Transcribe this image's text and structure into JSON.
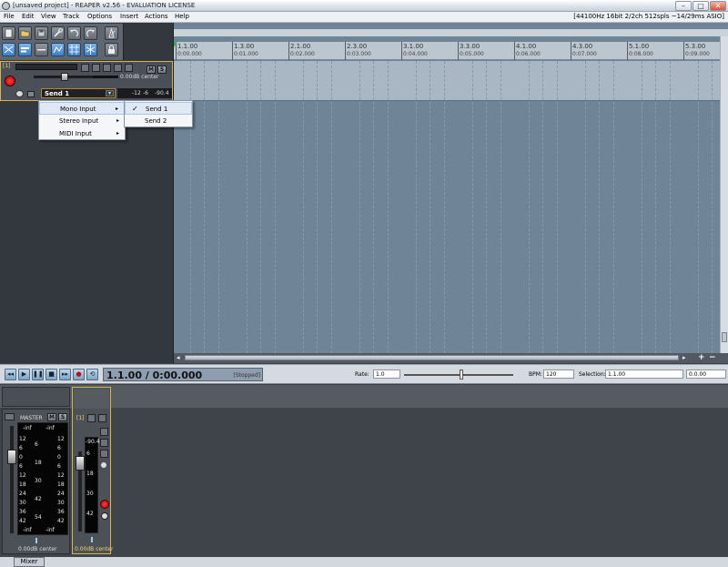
{
  "window": {
    "title": "[unsaved project] - REAPER v2.56 - EVALUATION LICENSE",
    "minimize": "–",
    "maximize": "□",
    "close": "✕"
  },
  "menu": [
    "File",
    "Edit",
    "View",
    "Track",
    "Options",
    "Insert",
    "Actions",
    "Help"
  ],
  "audio_status": "[44100Hz 16bit 2/2ch 512spls ~14/29ms ASIO]",
  "toolbar": {
    "buttons": [
      "new-project",
      "open-project",
      "save-project",
      "settings-wrench",
      "undo",
      "redo",
      "metronome",
      "auto-crossfade",
      "ripple-edit",
      "envelope-lock",
      "grid-snap",
      "snap-toggle",
      "lock"
    ]
  },
  "track": {
    "number": "[1]",
    "name": "",
    "volume": "0.00dB center",
    "mute": "M",
    "solo": "S",
    "send_name": "Send 1",
    "meter": [
      "-12",
      "-6",
      "-90.4"
    ]
  },
  "ruler": {
    "marks": [
      {
        "bar": "1.1.00",
        "time": "0:00.000"
      },
      {
        "bar": "1.3.00",
        "time": "0:01.000"
      },
      {
        "bar": "2.1.00",
        "time": "0:02.000"
      },
      {
        "bar": "2.3.00",
        "time": "0:03.000"
      },
      {
        "bar": "3.1.00",
        "time": "0:04.000"
      },
      {
        "bar": "3.3.00",
        "time": "0:05.000"
      },
      {
        "bar": "4.1.00",
        "time": "0:06.000"
      },
      {
        "bar": "4.3.00",
        "time": "0:07.000"
      },
      {
        "bar": "5.1.00",
        "time": "0:08.000"
      },
      {
        "bar": "5.3.00",
        "time": "0:09.000"
      }
    ]
  },
  "input_menu": {
    "items": [
      "Mono Input",
      "Stereo Input",
      "MIDI Input"
    ],
    "submenu": [
      "Send 1",
      "Send 2"
    ],
    "checked": "Send 1"
  },
  "transport": {
    "buttons": [
      "rewind",
      "play",
      "pause",
      "stop",
      "forward",
      "record",
      "repeat"
    ],
    "position": "1.1.00 / 0:00.000",
    "status": "[Stopped]",
    "rate_label": "Rate:",
    "rate_value": "1.0",
    "bpm_label": "BPM:",
    "bpm_value": "120",
    "selection_label": "Selection:",
    "selection_start": "1.1.00",
    "selection_end": "0.0.00"
  },
  "mixer": {
    "master_label": "MASTER",
    "master_peak_l": "-inf",
    "master_peak_r": "-inf",
    "master_bottom_l": "-inf",
    "master_bottom_r": "-inf",
    "master_volume": "0.00dB center",
    "mute": "M",
    "solo": "S",
    "track_num": "[1]",
    "track_peak": "-90.4",
    "track_volume": "0.00dB center",
    "scale_left": [
      "12",
      "6",
      "0",
      "6",
      "12",
      "18",
      "24",
      "30",
      "36",
      "42"
    ],
    "scale_mid": [
      "6",
      "18",
      "30",
      "42",
      "54"
    ],
    "scale_right": [
      "12",
      "6",
      "0",
      "6",
      "12",
      "18",
      "24",
      "30",
      "36",
      "42"
    ],
    "track_scale": [
      "6",
      "18",
      "30",
      "42"
    ],
    "tab": "Mixer"
  }
}
